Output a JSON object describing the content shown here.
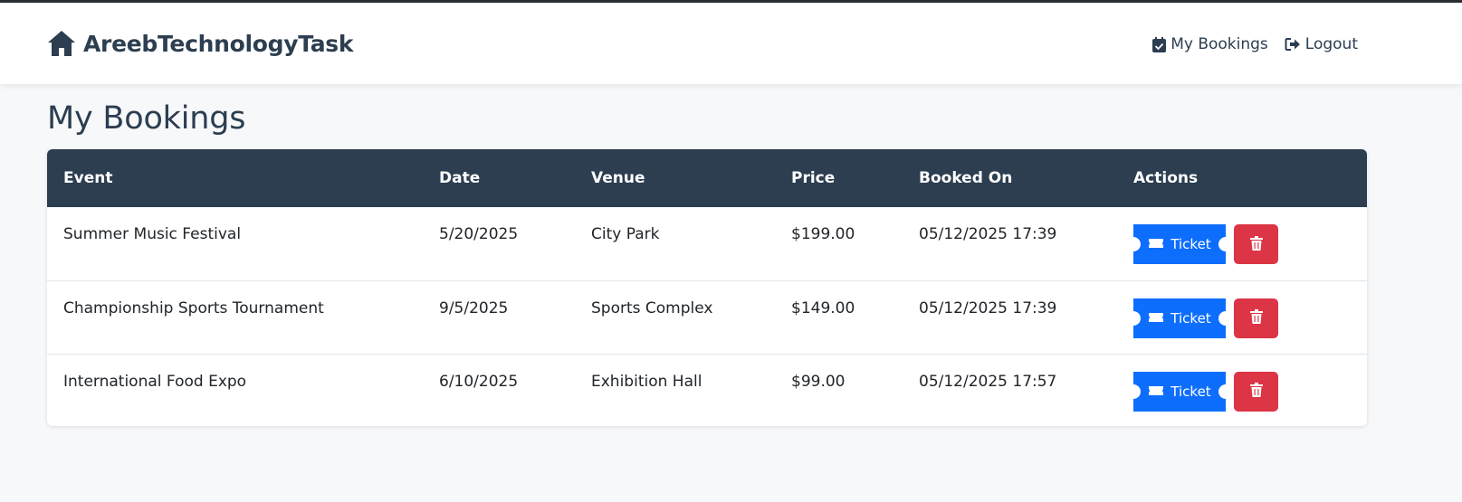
{
  "navbar": {
    "brand": "AreebTechnologyTask",
    "brand_icon": "home-icon",
    "links": [
      {
        "label": "My Bookings",
        "icon": "calendar-check-icon"
      },
      {
        "label": "Logout",
        "icon": "sign-out-icon"
      }
    ]
  },
  "page": {
    "title": "My Bookings"
  },
  "table": {
    "headers": [
      "Event",
      "Date",
      "Venue",
      "Price",
      "Booked On",
      "Actions"
    ],
    "rows": [
      {
        "event": "Summer Music Festival",
        "date": "5/20/2025",
        "venue": "City Park",
        "price": "$199.00",
        "booked_on": "05/12/2025 17:39",
        "ticket_label": "Ticket"
      },
      {
        "event": "Championship Sports Tournament",
        "date": "9/5/2025",
        "venue": "Sports Complex",
        "price": "$149.00",
        "booked_on": "05/12/2025 17:39",
        "ticket_label": "Ticket"
      },
      {
        "event": "International Food Expo",
        "date": "6/10/2025",
        "venue": "Exhibition Hall",
        "price": "$99.00",
        "booked_on": "05/12/2025 17:57",
        "ticket_label": "Ticket"
      }
    ]
  },
  "colors": {
    "header_bg": "#2c3e50",
    "ticket_button": "#0d6efd",
    "delete_button": "#dc3545",
    "page_bg": "#f7f8fa"
  }
}
